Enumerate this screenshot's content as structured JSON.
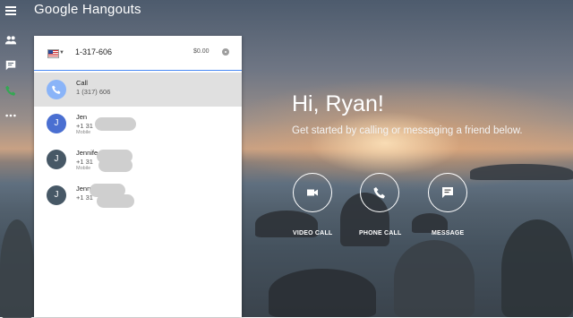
{
  "app": {
    "title": "Google Hangouts"
  },
  "rail": {
    "items": [
      {
        "icon": "contacts-icon"
      },
      {
        "icon": "messages-icon"
      },
      {
        "icon": "phone-icon",
        "color": "#34a853"
      },
      {
        "icon": "more-icon"
      }
    ]
  },
  "dialer": {
    "number": "1-317-606",
    "credit": "$0.00",
    "flag_icon": "us-flag-icon"
  },
  "contacts": [
    {
      "type": "call",
      "name": "Call",
      "sub": "1 (317) 606",
      "avatar_icon": "phone-icon"
    },
    {
      "name": "Jen",
      "sub": "+1 31",
      "tiny": "Mobile",
      "initial": "J",
      "color": "#4a6fd1"
    },
    {
      "name": "Jennife",
      "sub": "+1 31",
      "tiny": "Mobile",
      "initial": "J",
      "color": "#475866"
    },
    {
      "name": "Jenn",
      "sub": "+1 31",
      "initial": "J",
      "color": "#475866"
    }
  ],
  "hero": {
    "title": "Hi, Ryan!",
    "subtitle": "Get started by calling or messaging a friend below."
  },
  "actions": [
    {
      "label": "VIDEO CALL",
      "icon": "video-camera-icon"
    },
    {
      "label": "PHONE CALL",
      "icon": "phone-icon"
    },
    {
      "label": "MESSAGE",
      "icon": "message-icon"
    }
  ]
}
